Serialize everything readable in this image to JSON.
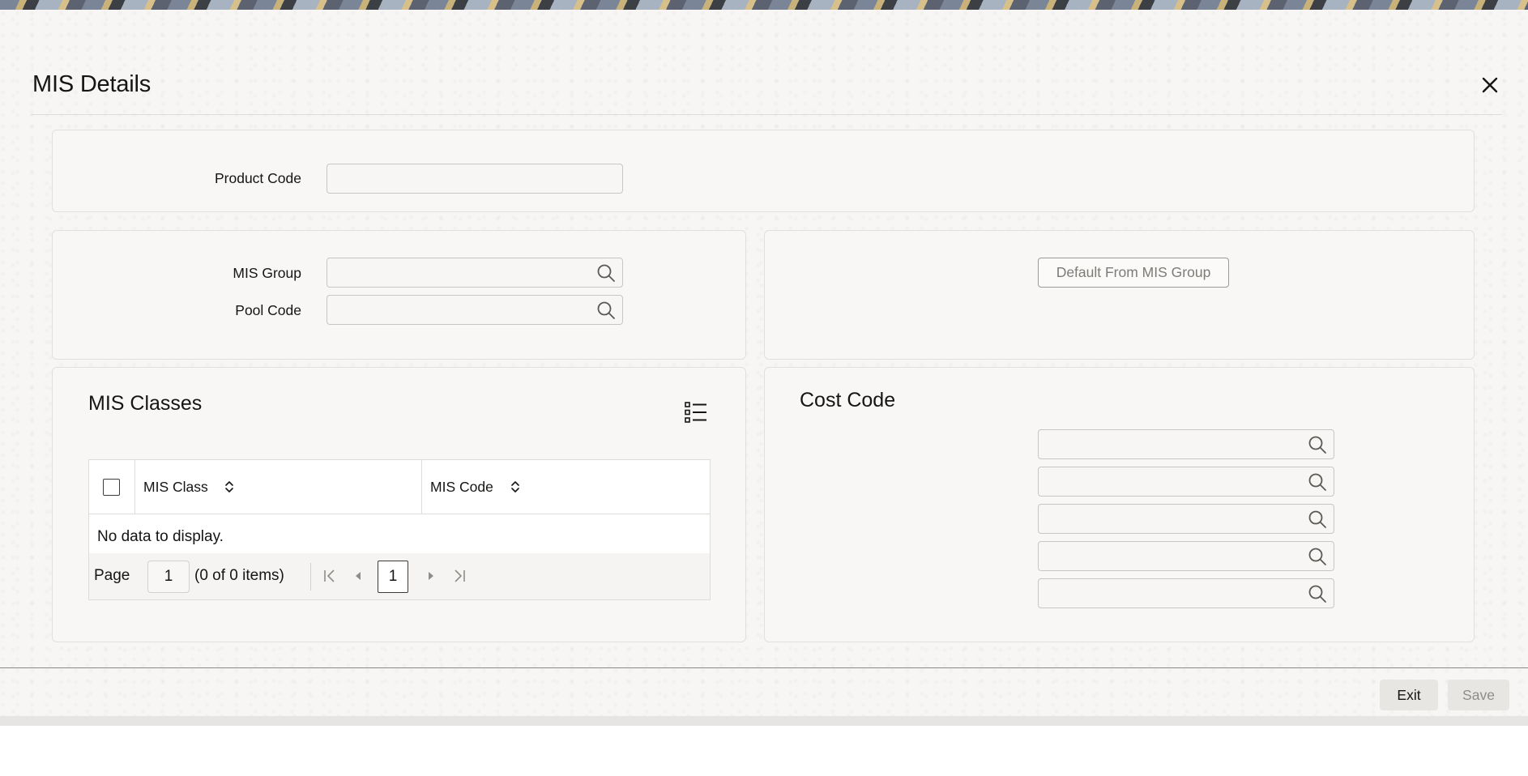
{
  "dialog": {
    "title": "MIS Details"
  },
  "product": {
    "code_label": "Product Code",
    "code_value": ""
  },
  "mis": {
    "group_label": "MIS Group",
    "group_value": "",
    "pool_label": "Pool Code",
    "pool_value": ""
  },
  "default_button_label": "Default From MIS Group",
  "classes": {
    "title": "MIS Classes",
    "columns": [
      "MIS Class",
      "MIS Code"
    ],
    "rows": [],
    "empty_text": "No data to display.",
    "pager": {
      "page_label": "Page",
      "page_value": "1",
      "count_text": "(0 of 0 items)",
      "current_page": "1"
    }
  },
  "cost": {
    "title": "Cost Code",
    "fields": [
      "",
      "",
      "",
      "",
      ""
    ]
  },
  "footer": {
    "exit_label": "Exit",
    "save_label": "Save"
  },
  "icons": {
    "close": "close-icon",
    "search": "search-icon",
    "list": "list-view-icon",
    "sort": "sort-icon",
    "first": "first-page-icon",
    "prev": "prev-page-icon",
    "next": "next-page-icon",
    "last": "last-page-icon"
  }
}
